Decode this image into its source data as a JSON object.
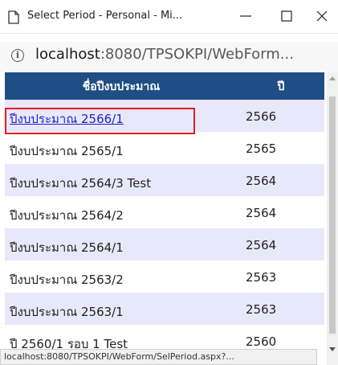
{
  "window": {
    "title": "Select Period - Personal - Mi...",
    "icons": {
      "page": "page-icon",
      "minimize": "minimize-icon",
      "maximize": "maximize-icon",
      "close": "close-icon"
    }
  },
  "address_bar": {
    "info_icon": "info-icon",
    "host": "localhost",
    "path": ":8080/TPSOKPI/WebForm..."
  },
  "table": {
    "columns": [
      "ชื่อปีงบประมาณ",
      "ปี"
    ],
    "rows": [
      {
        "name": "ปีงบประมาณ 2566/1",
        "year": "2566",
        "is_link": true,
        "highlighted": true
      },
      {
        "name": "ปีงบประมาณ 2565/1",
        "year": "2565"
      },
      {
        "name": "ปีงบประมาณ 2564/3 Test",
        "year": "2564"
      },
      {
        "name": "ปีงบประมาณ 2564/2",
        "year": "2564"
      },
      {
        "name": "ปีงบประมาณ 2564/1",
        "year": "2564"
      },
      {
        "name": "ปีงบประมาณ 2563/2",
        "year": "2563"
      },
      {
        "name": "ปีงบประมาณ 2563/1",
        "year": "2563"
      },
      {
        "name": "ปี 2560/1 รอบ 1 Test",
        "year": "2560"
      }
    ]
  },
  "status_bar": {
    "text": "localhost:8080/TPSOKPI/WebForm/SelPeriod.aspx?..."
  },
  "colors": {
    "header_bg": "#1f4e85",
    "alt_row_bg": "#e8e8fa",
    "link": "#2222cc",
    "highlight_border": "#e31c23"
  }
}
